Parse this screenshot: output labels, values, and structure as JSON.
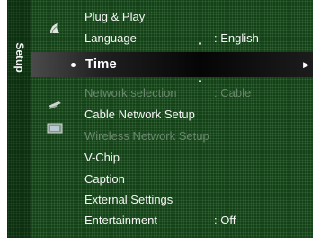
{
  "side_tab": {
    "label": "Setup"
  },
  "menu": {
    "items": [
      {
        "label": "Plug & Play",
        "value": ""
      },
      {
        "label": "Language",
        "value": ": English"
      },
      {
        "label": "Time",
        "value": ""
      },
      {
        "label": "Network selection",
        "value": ": Cable"
      },
      {
        "label": "Cable Network Setup",
        "value": ""
      },
      {
        "label": "Wireless Network Setup",
        "value": ""
      },
      {
        "label": "V-Chip",
        "value": ""
      },
      {
        "label": "Caption",
        "value": ""
      },
      {
        "label": "External Settings",
        "value": ""
      },
      {
        "label": "Entertainment",
        "value": ": Off"
      }
    ]
  },
  "icons": [
    "picture-icon",
    "sound-icon",
    "setup-gear-icon",
    "input-icon",
    "support-icon"
  ],
  "colors": {
    "screen_bg": "#0e3a12",
    "highlight": "#050505",
    "text": "#f5f5f5",
    "disabled_text": "#6a876c"
  }
}
